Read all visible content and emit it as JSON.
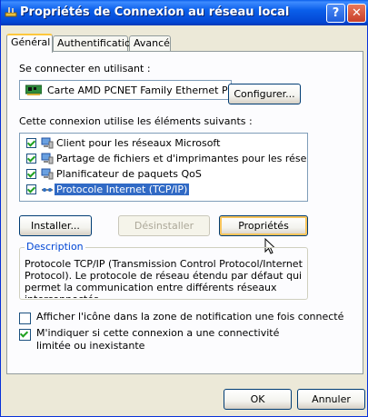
{
  "window": {
    "title": "Propriétés de Connexion au réseau local",
    "help_button": "?",
    "close_button": "✕"
  },
  "tabs": [
    {
      "label": "Général",
      "active": true
    },
    {
      "label": "Authentification",
      "active": false
    },
    {
      "label": "Avancé",
      "active": false
    }
  ],
  "general": {
    "connect_using_label": "Se connecter en utilisant :",
    "adapter_name": "Carte AMD PCNET Family Ethernet P",
    "configure_button": "Configurer...",
    "items_label": "Cette connexion utilise les éléments suivants :",
    "items": [
      {
        "label": "Client pour les réseaux Microsoft",
        "checked": true,
        "selected": false,
        "icon": "network-client-icon"
      },
      {
        "label": "Partage de fichiers et d'imprimantes pour les réseaux Mi...",
        "checked": true,
        "selected": false,
        "icon": "file-printer-sharing-icon"
      },
      {
        "label": "Planificateur de paquets QoS",
        "checked": true,
        "selected": false,
        "icon": "qos-scheduler-icon"
      },
      {
        "label": "Protocole Internet (TCP/IP)",
        "checked": true,
        "selected": true,
        "icon": "protocol-icon"
      }
    ],
    "install_button": "Installer...",
    "uninstall_button": "Désinstaller",
    "properties_button": "Propriétés",
    "description_title": "Description",
    "description_text": "Protocole TCP/IP (Transmission Control Protocol/Internet Protocol). Le protocole de réseau étendu par défaut qui permet la communication entre différents réseaux interconnectés.",
    "show_icon_option": {
      "label": "Afficher l'icône dans la zone de notification une fois connecté",
      "checked": false
    },
    "notify_option": {
      "label": "M'indiquer si cette connexion a une connectivité limitée ou inexistante",
      "checked": true
    }
  },
  "footer": {
    "ok_button": "OK",
    "cancel_button": "Annuler"
  }
}
